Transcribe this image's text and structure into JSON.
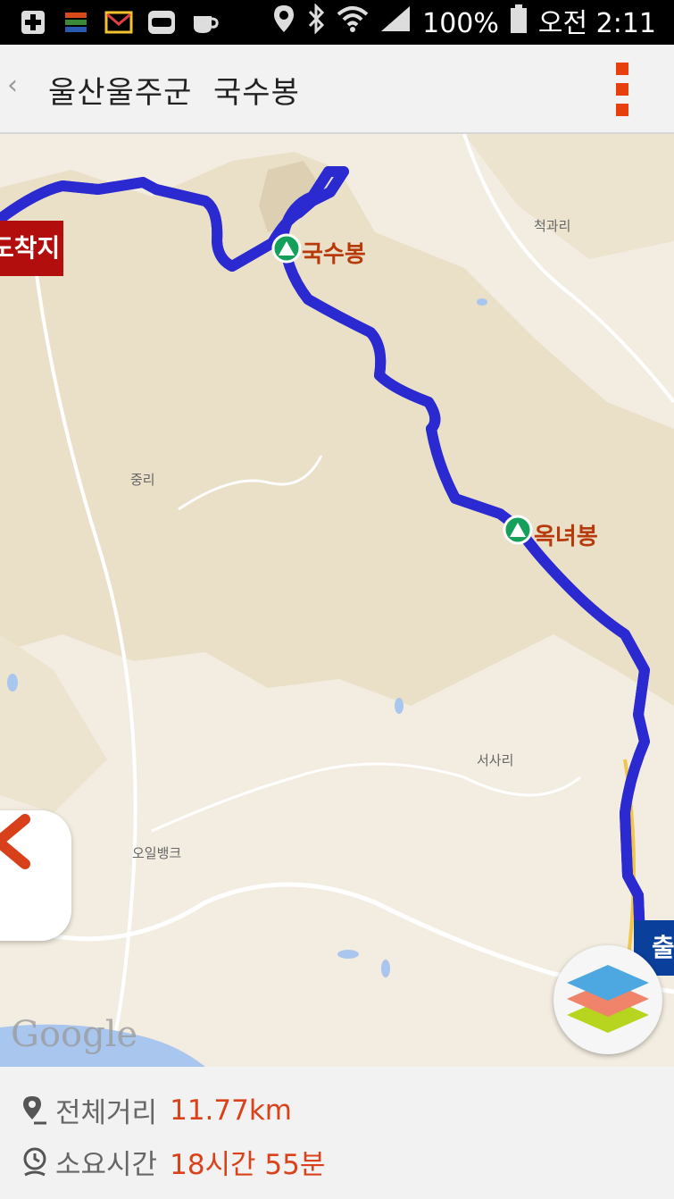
{
  "status_bar": {
    "battery": "100%",
    "time": "오전 2:11",
    "notification_icons": [
      "plus-box-icon",
      "app-icon",
      "mail-icon",
      "band-icon",
      "coffee-icon"
    ],
    "system_icons": [
      "location-icon",
      "bluetooth-icon",
      "wifi-icon",
      "signal-icon",
      "battery-icon"
    ]
  },
  "app_bar": {
    "back_symbol": "‹",
    "title": "울산울주군  국수봉",
    "menu_icon": "more-vert-icon",
    "accent_color": "#e8400c"
  },
  "map": {
    "peaks": [
      {
        "name": "국수봉"
      },
      {
        "name": "옥녀봉"
      }
    ],
    "places": [
      "척과리",
      "중리",
      "서사리",
      "오일뱅크"
    ],
    "arrive_label": "도착지",
    "depart_label": "출",
    "attribution": "Google",
    "route_color": "#2a2ad0",
    "route_fill_color": "#8c8c8c",
    "buttons": {
      "back_icon": "chevron-left-icon",
      "layers_icon": "layers-icon"
    }
  },
  "summary": {
    "distance_label": "전체거리",
    "distance_value": "11.77km",
    "time_label": "소요시간",
    "time_value": "18시간 55분",
    "value_color": "#d9421a"
  }
}
